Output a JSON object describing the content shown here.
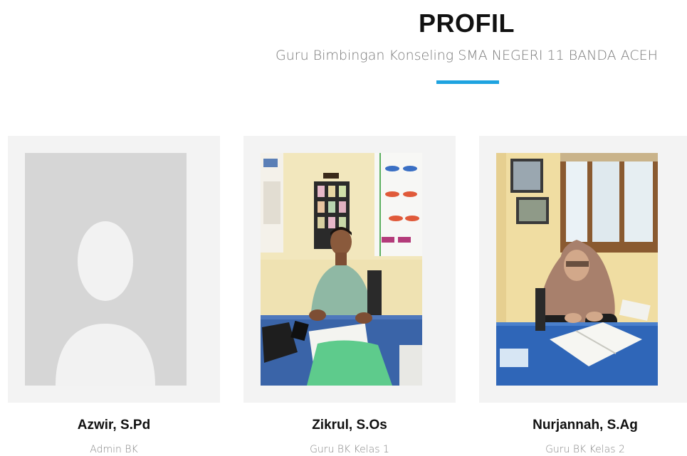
{
  "header": {
    "title": "PROFIL",
    "subtitle": "Guru Bimbingan Konseling SMA NEGERI 11 BANDA ACEH",
    "accent_color": "#1ea3e0"
  },
  "profiles": [
    {
      "name": "Azwir, S.Pd",
      "role": "Admin BK",
      "photo": "placeholder-avatar-icon"
    },
    {
      "name": "Zikrul, S.Os",
      "role": "Guru BK Kelas 1",
      "photo": "teacher-photo-male"
    },
    {
      "name": "Nurjannah, S.Ag",
      "role": "Guru BK Kelas 2",
      "photo": "teacher-photo-female"
    }
  ]
}
